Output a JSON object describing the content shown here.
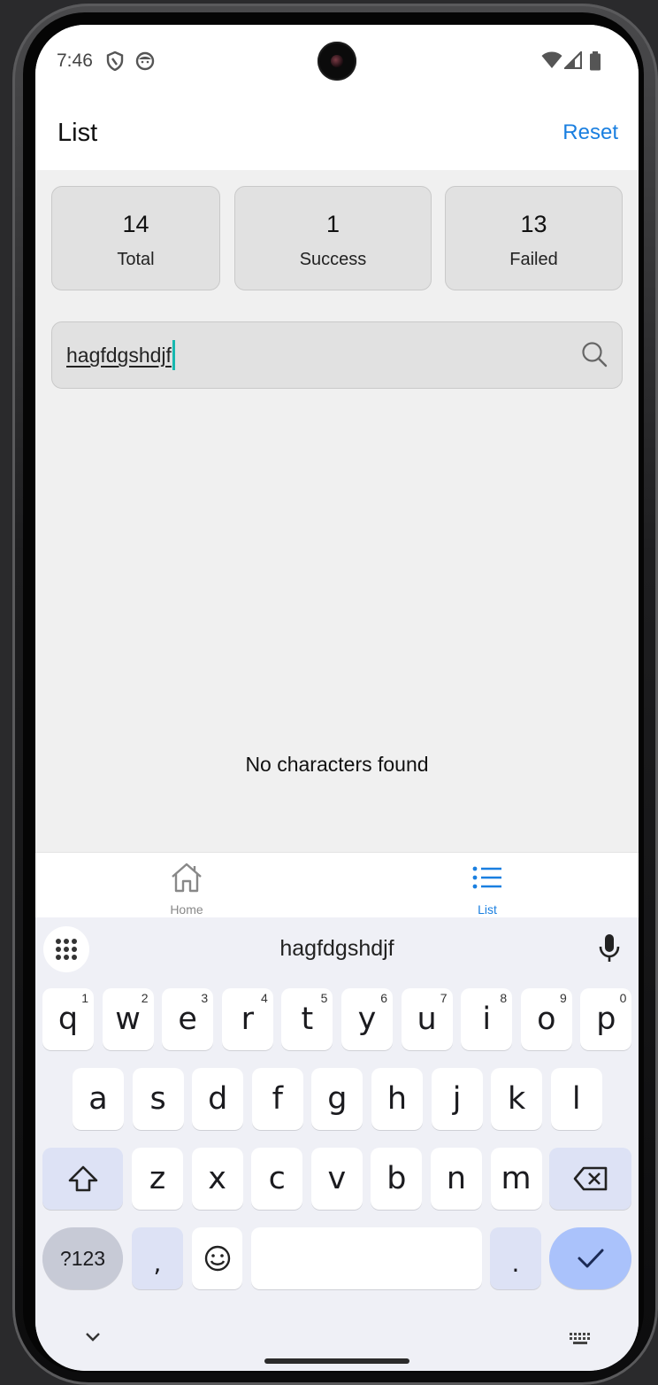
{
  "status_bar": {
    "time": "7:46"
  },
  "header": {
    "title": "List",
    "reset_label": "Reset"
  },
  "stats": [
    {
      "value": "14",
      "label": "Total"
    },
    {
      "value": "1",
      "label": "Success"
    },
    {
      "value": "13",
      "label": "Failed"
    }
  ],
  "search": {
    "value": "hagfdgshdjf"
  },
  "empty_message": "No characters found",
  "bottom_nav": {
    "items": [
      {
        "label": "Home",
        "icon": "home-icon",
        "active": false
      },
      {
        "label": "List",
        "icon": "list-icon",
        "active": true
      }
    ]
  },
  "keyboard": {
    "suggestion": "hagfdgshdjf",
    "row1": [
      {
        "key": "q",
        "hint": "1"
      },
      {
        "key": "w",
        "hint": "2"
      },
      {
        "key": "e",
        "hint": "3"
      },
      {
        "key": "r",
        "hint": "4"
      },
      {
        "key": "t",
        "hint": "5"
      },
      {
        "key": "y",
        "hint": "6"
      },
      {
        "key": "u",
        "hint": "7"
      },
      {
        "key": "i",
        "hint": "8"
      },
      {
        "key": "o",
        "hint": "9"
      },
      {
        "key": "p",
        "hint": "0"
      }
    ],
    "row2": [
      "a",
      "s",
      "d",
      "f",
      "g",
      "h",
      "j",
      "k",
      "l"
    ],
    "row3": [
      "z",
      "x",
      "c",
      "v",
      "b",
      "n",
      "m"
    ],
    "symbols_label": "?123",
    "comma_label": ",",
    "period_label": "."
  },
  "colors": {
    "accent": "#1a7fe0",
    "content_bg": "#f0f0f0",
    "card_bg": "#e1e1e1",
    "keyboard_bg": "#eff0f6",
    "enter_key": "#aac2fb",
    "caret": "#17b8b0"
  }
}
